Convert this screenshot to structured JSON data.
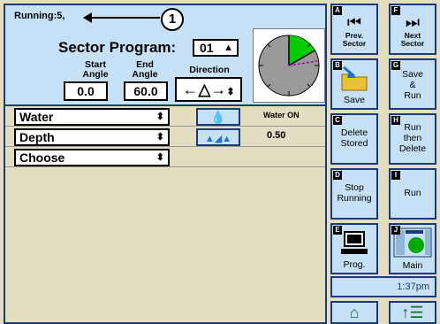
{
  "status": {
    "running": "Running:5,",
    "callout_number": "1"
  },
  "sector_program": {
    "label": "Sector Program:",
    "value": "01"
  },
  "angles": {
    "start_label": "Start\nAngle",
    "end_label": "End\nAngle",
    "direction_label": "Direction",
    "start_value": "0.0",
    "end_value": "60.0"
  },
  "rows": [
    {
      "select": "Water",
      "icon": "water-drop-icon",
      "text": "Water ON",
      "value": ""
    },
    {
      "select": "Depth",
      "icon": "depth-drops-icon",
      "text": "",
      "value": "0.50"
    },
    {
      "select": "Choose",
      "icon": "",
      "text": "",
      "value": ""
    }
  ],
  "buttons": [
    {
      "letter": "A",
      "label_line1": "Prev.",
      "label_line2": "Sector"
    },
    {
      "letter": "F",
      "label_line1": "Next",
      "label_line2": "Sector"
    },
    {
      "letter": "B",
      "label_line1": "Save",
      "label_line2": ""
    },
    {
      "letter": "G",
      "label_line1": "Save",
      "label_line2": "&",
      "label_line3": "Run"
    },
    {
      "letter": "C",
      "label_line1": "Delete",
      "label_line2": "Stored"
    },
    {
      "letter": "H",
      "label_line1": "Run",
      "label_line2": "then",
      "label_line3": "Delete"
    },
    {
      "letter": "D",
      "label_line1": "Stop",
      "label_line2": "Running"
    },
    {
      "letter": "I",
      "label_line1": "Run",
      "label_line2": ""
    },
    {
      "letter": "E",
      "label_line1": "Prog.",
      "label_line2": ""
    },
    {
      "letter": "J",
      "label_line1": "Main",
      "label_line2": ""
    }
  ],
  "time": "1:37pm",
  "colors": {
    "panel_bg": "#c6e1f5",
    "frame_bg": "#e3dec1",
    "border": "#1b3a7a",
    "sector_fill": "#00cc00"
  },
  "icons": {
    "home": "home-icon",
    "scroll": "scroll-up-icon",
    "direction": "direction-arrows-icon"
  }
}
